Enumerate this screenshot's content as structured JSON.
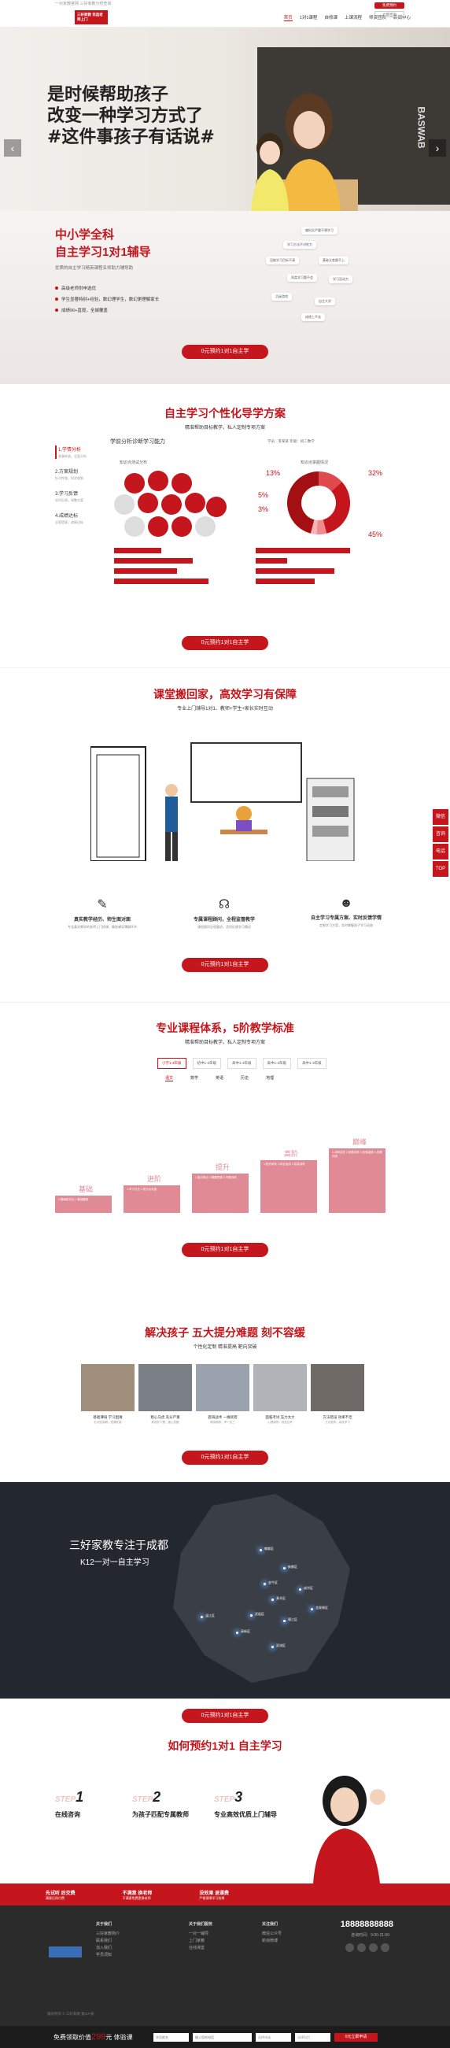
{
  "header": {
    "top_links": "一对家教官网  三好家教分校查询",
    "logo": "三好家教 优选老师上门",
    "nav": [
      "首页",
      "1对1课程",
      "自修课",
      "上课流程",
      "师资团队",
      "新闻中心"
    ],
    "btn_a": "免费预约",
    "btn_b": "立即咨询"
  },
  "banner": {
    "line1": "是时候帮助孩子",
    "line2": "改变一种学习方式了",
    "line3": "#这件事孩子有话说#",
    "board_text": "BASWAB"
  },
  "intro": {
    "title1": "中小学全科",
    "title2": "自主学习1对1辅导",
    "desc": "优质的自主学习精英课程名师助力辅导助",
    "points": [
      "高级老师供申选优",
      "学生显著特别+经验，数幻理学生，数幻更理解家长",
      "成绩90+直提，全城覆盖"
    ],
    "bubbles": [
      "偏科太严重不想学习",
      "学习方法不对吃力",
      "没能学习目标不清",
      "基础太差跟不上",
      "同类学习题不会",
      "学习没动力",
      "沉迷游戏",
      "自主大学",
      "成绩上不去"
    ],
    "cta": "0元预约1对1自主学"
  },
  "solution": {
    "title": "自主学习个性化导学方案",
    "subtitle": "精准帮助目标教学，私人定制专项方案",
    "side": [
      {
        "label": "1.学情分析",
        "sub": "查漏补缺，全面分析"
      },
      {
        "label": "2.方案规划",
        "sub": "针对性强，科学规划"
      },
      {
        "label": "3.学习反馈",
        "sub": "实时反馈，调整方案"
      },
      {
        "label": "4.成绩达标",
        "sub": "全面提高，成绩达标"
      }
    ],
    "heading": "学前分析诊断学习能力",
    "chart_left_label": "知识点测试分布",
    "chart_right_label": "知识点掌握情况",
    "student": "学员：李某某  年级：初二数学",
    "cta": "0元预约1对1自主学"
  },
  "chart_data": {
    "type": "pie",
    "categories": [
      "",
      "",
      "",
      "",
      ""
    ],
    "values": [
      13,
      32,
      5,
      3,
      45
    ],
    "labels": [
      "13%",
      "32%",
      "5%",
      "3%",
      "45%"
    ]
  },
  "classroom": {
    "title": "课堂搬回家，高效学习有保障",
    "subtitle": "专业上门辅导1对1、教师+学生+家长实时互动",
    "features": [
      {
        "title": "真实教学经历、师生面对面",
        "desc": "专业真实教学的老师上门授课，精准辅导薄弱环节"
      },
      {
        "title": "专属课程顾问，全程监督教学",
        "desc": "课程顾问全程跟进，及时反馈学习情况"
      },
      {
        "title": "自主学习专属方案、实时反馈学情",
        "desc": "定制学习方案，实时掌握孩子学习动态"
      }
    ],
    "cta": "0元预约1对1自主学"
  },
  "course": {
    "title": "专业课程体系，5阶教学标准",
    "subtitle": "精准帮助目标教学，私人定制专项方案",
    "tabs": [
      "小学1-3年级",
      "初中1-3年级",
      "高中1-3年级",
      "高中1-3年级",
      "高中1-3年级"
    ],
    "subjects": [
      "语文",
      "数学",
      "英语",
      "历史",
      "地理"
    ],
    "levels": [
      {
        "name": "基础",
        "desc": "1.基础知识点 2.基础题型"
      },
      {
        "name": "进阶",
        "desc": "1.学习方法 2.知识点巩固"
      },
      {
        "name": "提升",
        "desc": "1.重点难点 2.解题思路 3.专题训练"
      },
      {
        "name": "高阶",
        "desc": "1.知识体系 2.综合运用 3.拔高训练"
      },
      {
        "name": "巅峰",
        "desc": "1.冲刺名校 2.竞赛训练 3.压轴突破 4.查漏补缺"
      }
    ],
    "cta": "0元预约1对1自主学"
  },
  "solve": {
    "title": "解决孩子 五大提分难题 刻不容缓",
    "subtitle": "个性化定制 精准提高 靶向突破",
    "items": [
      {
        "title": "基础薄弱 学习困难",
        "sub": "针对性讲解，查漏补缺"
      },
      {
        "title": "粗心马虎 丢分严重",
        "sub": "养成好习惯，细心答题"
      },
      {
        "title": "题海战术 一做就错",
        "sub": "精讲精练，举一反三"
      },
      {
        "title": "面临考试 压力太大",
        "sub": "心理疏导，轻松应考"
      },
      {
        "title": "方法错误 效果不佳",
        "sub": "方法指导，高效学习"
      }
    ],
    "cta": "0元预约1对1自主学"
  },
  "map": {
    "title1": "三好家教专注于成都",
    "title2": "K12一对一自主学习",
    "places": [
      "郫都区",
      "新都区",
      "金牛区",
      "成华区",
      "龙泉驿区",
      "青羊区",
      "锦江区",
      "武侯区",
      "高新区",
      "双流区",
      "温江区"
    ],
    "cta": "0元预约1对1自主学"
  },
  "booking": {
    "title": "如何预约1对1 自主学习",
    "steps": [
      {
        "num": "1",
        "ghost": "STEP",
        "label": "在线咨询"
      },
      {
        "num": "2",
        "ghost": "STEP",
        "label": "为孩子匹配专属教师"
      },
      {
        "num": "3",
        "ghost": "STEP",
        "label": "专业高效优质上门辅导"
      }
    ]
  },
  "strip": [
    {
      "title": "先试听 后交费",
      "sub": "满意后再付费"
    },
    {
      "title": "不满意 换老师",
      "sub": "不满意免费更换老师"
    },
    {
      "title": "没效果 退课费",
      "sub": "严格保障学习效果"
    }
  ],
  "footer": {
    "cols": [
      {
        "title": "关于我们",
        "items": [
          "三好家教简介",
          "联系我们",
          "加入我们",
          "学员须知"
        ]
      },
      {
        "title": "关于我们服务",
        "items": [
          "一对一辅导",
          "上门家教",
          "在线课堂"
        ]
      },
      {
        "title": "关注我们",
        "items": [
          "微信公众号",
          "新浪微博"
        ]
      }
    ],
    "phone": "18888888888",
    "time": "咨询时间：9:00-21:00",
    "copyright": "版权所有 © 三好家教 蜀ICP备"
  },
  "bottombar": {
    "free_prefix": "免费领取价值",
    "free_price": "299",
    "free_suffix": "元 体验课",
    "ph_name": "学员姓名",
    "ph_phone": "输入您的电话",
    "ph_grade": "选择年级",
    "ph_subject": "选择科目",
    "submit": "0元立即申请"
  },
  "float": [
    "微信",
    "咨询",
    "电话",
    "TOP"
  ]
}
